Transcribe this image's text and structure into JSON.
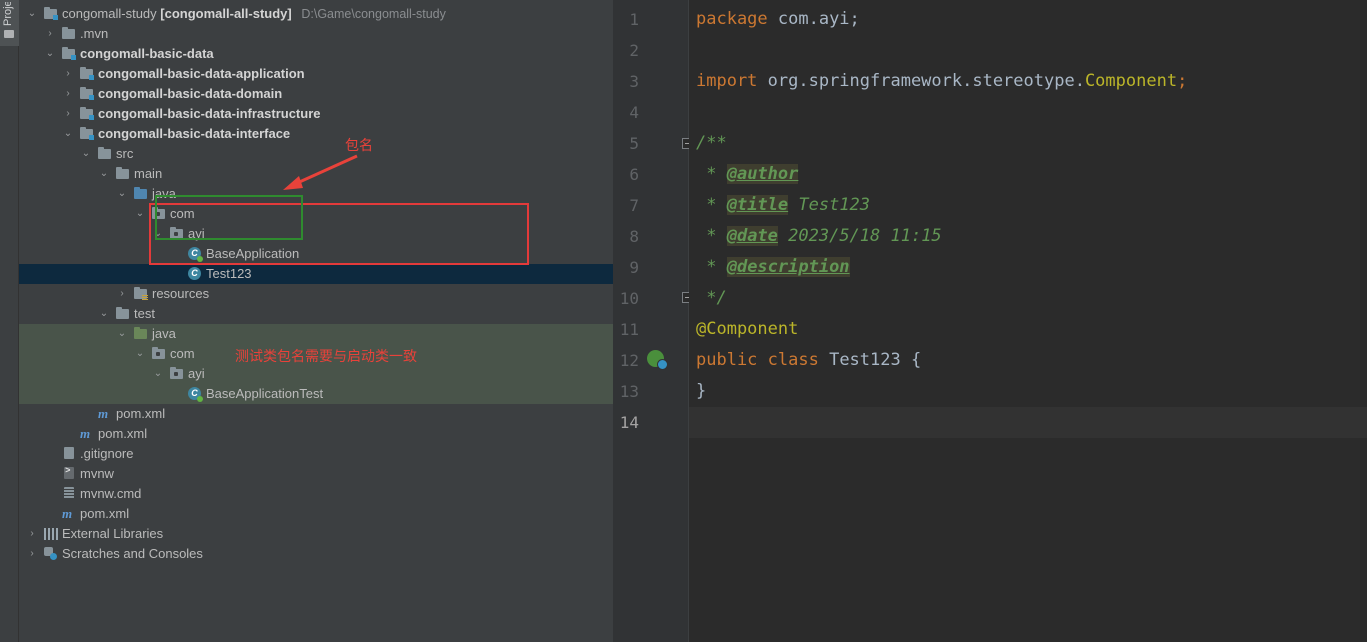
{
  "sidebar": {
    "vertical_tab": "Project"
  },
  "project": {
    "root_name": "congomall-study",
    "root_module": "[congomall-all-study]",
    "root_path": "D:\\Game\\congomall-study",
    "items": [
      {
        "label": ".mvn"
      },
      {
        "label": "congomall-basic-data"
      },
      {
        "label": "congomall-basic-data-application"
      },
      {
        "label": "congomall-basic-data-domain"
      },
      {
        "label": "congomall-basic-data-infrastructure"
      },
      {
        "label": "congomall-basic-data-interface"
      },
      {
        "label": "src"
      },
      {
        "label": "main"
      },
      {
        "label": "java"
      },
      {
        "label": "com"
      },
      {
        "label": "ayi"
      },
      {
        "label": "BaseApplication"
      },
      {
        "label": "Test123"
      },
      {
        "label": "resources"
      },
      {
        "label": "test"
      },
      {
        "label": "java"
      },
      {
        "label": "com"
      },
      {
        "label": "ayi"
      },
      {
        "label": "BaseApplicationTest"
      },
      {
        "label": "pom.xml"
      },
      {
        "label": "pom.xml"
      },
      {
        "label": ".gitignore"
      },
      {
        "label": "mvnw"
      },
      {
        "label": "mvnw.cmd"
      },
      {
        "label": "pom.xml"
      },
      {
        "label": "External Libraries"
      },
      {
        "label": "Scratches and Consoles"
      }
    ],
    "annotations": {
      "package_name": "包名",
      "test_note": "测试类包名需要与启动类一致"
    }
  },
  "editor": {
    "line_numbers": [
      "1",
      "2",
      "3",
      "4",
      "5",
      "6",
      "7",
      "8",
      "9",
      "10",
      "11",
      "12",
      "13",
      "14"
    ],
    "code": {
      "l1_kw": "package",
      "l1_rest": " com.ayi;",
      "l3_kw": "import",
      "l3_pkg": " org.springframework.stereotype.",
      "l3_cls": "Component",
      "l3_end": ";",
      "l5": "/**",
      "l6_star": " * ",
      "l6_tag": "@author",
      "l7_star": " * ",
      "l7_tag": "@title",
      "l7_text": " Test123",
      "l8_star": " * ",
      "l8_tag": "@date",
      "l8_text": " 2023/5/18 11:15",
      "l9_star": " * ",
      "l9_tag": "@description",
      "l10": " */",
      "l11": "@Component",
      "l12_kw1": "public",
      "l12_kw2": " class",
      "l12_rest": " Test123 {",
      "l13": "}"
    }
  },
  "colors": {
    "panel_bg": "#3c3f41",
    "editor_bg": "#2b2b2b",
    "selection": "#0d293e",
    "annotation_red": "#e33a3a",
    "annotation_green": "#2f8b2f"
  }
}
